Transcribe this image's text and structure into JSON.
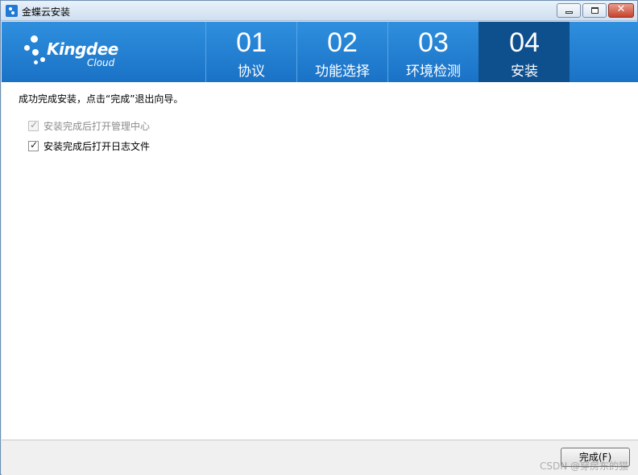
{
  "window": {
    "title": "金蝶云安装"
  },
  "brand": {
    "name": "Kingdee",
    "sub": "Cloud"
  },
  "steps": [
    {
      "num": "01",
      "label": "协议"
    },
    {
      "num": "02",
      "label": "功能选择"
    },
    {
      "num": "03",
      "label": "环境检测"
    },
    {
      "num": "04",
      "label": "安装"
    }
  ],
  "main": {
    "message": "成功完成安装，点击“完成”退出向导。",
    "options": [
      {
        "label": "安装完成后打开管理中心",
        "checked": true,
        "disabled": true
      },
      {
        "label": "安装完成后打开日志文件",
        "checked": true,
        "disabled": false
      }
    ]
  },
  "footer": {
    "finish_label": "完成(F)",
    "watermark": "CSDN @穿房东的猫"
  },
  "colors": {
    "header": "#1a72c6",
    "active_step": "#0e4f8e"
  }
}
